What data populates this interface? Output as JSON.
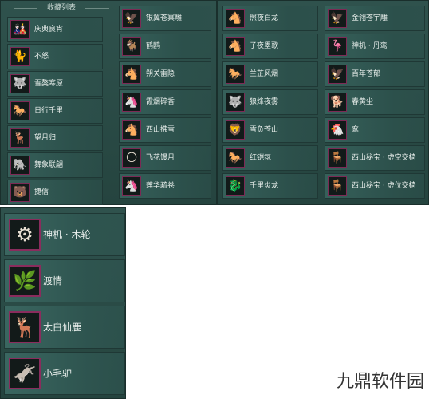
{
  "panels": {
    "a_header": "收藏列表",
    "a_col1": [
      {
        "label": "庆典良宵",
        "icon": "🎎"
      },
      {
        "label": "不怒",
        "icon": "🐈"
      },
      {
        "label": "雪獒寒原",
        "icon": "🐺"
      },
      {
        "label": "日行千里",
        "icon": "🐎"
      },
      {
        "label": "望月归",
        "icon": "🦌"
      },
      {
        "label": "舞象联翩",
        "icon": "🐘"
      },
      {
        "label": "捷信",
        "icon": "🐻"
      }
    ],
    "a_col2": [
      {
        "label": "银翼苍冥雕",
        "icon": "🦅"
      },
      {
        "label": "鹤鸥",
        "icon": "🐐"
      },
      {
        "label": "朔关雷隐",
        "icon": "🐴"
      },
      {
        "label": "霞烟碎香",
        "icon": "🦄"
      },
      {
        "label": "西山拂雪",
        "icon": "🐴"
      },
      {
        "label": "飞花馒月",
        "icon": "🌕"
      },
      {
        "label": "莲华疏卷",
        "icon": "🦄"
      }
    ],
    "b_col1": [
      {
        "label": "照夜白龙",
        "icon": "🐴"
      },
      {
        "label": "子夜墨歌",
        "icon": "🐴"
      },
      {
        "label": "兰芷风烟",
        "icon": "🐎"
      },
      {
        "label": "狼烽夜雾",
        "icon": "🐺"
      },
      {
        "label": "雪负苍山",
        "icon": "🦁"
      },
      {
        "label": "红铠氛",
        "icon": "🐎"
      },
      {
        "label": "千里炎龙",
        "icon": "🐉"
      }
    ],
    "b_col2": [
      {
        "label": "金翎苍宇雕",
        "icon": "🦅"
      },
      {
        "label": "神机 · 丹鸾",
        "icon": "🦩"
      },
      {
        "label": "百年苍郁",
        "icon": "🦅"
      },
      {
        "label": "春黄尘",
        "icon": "🐕"
      },
      {
        "label": "鸾",
        "icon": "🐔"
      },
      {
        "label": "西山秘宝 · 虚空交椅",
        "icon": "🪑"
      },
      {
        "label": "西山秘宝 · 虚位交椅",
        "icon": "🪑"
      }
    ],
    "c_items": [
      {
        "label": "神机 · 木轮",
        "icon": "⚙"
      },
      {
        "label": "渡情",
        "icon": "🌿"
      },
      {
        "label": "太白仙鹿",
        "icon": "🦌"
      },
      {
        "label": "小毛驴",
        "icon": "🫏"
      }
    ]
  },
  "watermark": "九鼎软件园",
  "colors": {
    "panel_bg": "#2f524d",
    "icon_border": "#7c2a55",
    "text": "#e9efec"
  }
}
